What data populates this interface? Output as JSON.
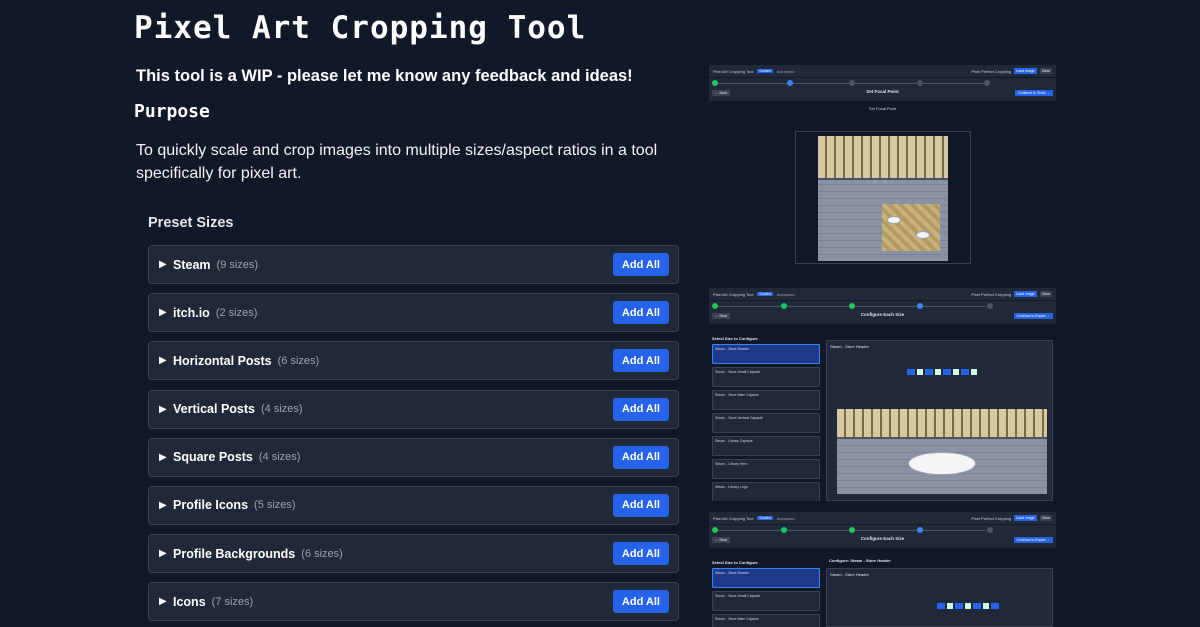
{
  "title": "Pixel Art Cropping Tool",
  "wip_notice": "This tool is a WIP - please let me know any feedback and ideas!",
  "purpose": {
    "heading": "Purpose",
    "text": "To quickly scale and crop images into multiple sizes/aspect ratios in a tool specifically for pixel art."
  },
  "presets": {
    "heading": "Preset Sizes",
    "add_label": "Add All",
    "items": [
      {
        "name": "Steam",
        "count": "(9 sizes)"
      },
      {
        "name": "itch.io",
        "count": "(2 sizes)"
      },
      {
        "name": "Horizontal Posts",
        "count": "(6 sizes)"
      },
      {
        "name": "Vertical Posts",
        "count": "(4 sizes)"
      },
      {
        "name": "Square Posts",
        "count": "(4 sizes)"
      },
      {
        "name": "Profile Icons",
        "count": "(5 sizes)"
      },
      {
        "name": "Profile Backgrounds",
        "count": "(6 sizes)"
      },
      {
        "name": "Icons",
        "count": "(7 sizes)"
      }
    ]
  },
  "screenshots": {
    "app_title": "Pixel Art Cropping Tool",
    "badge": "Guided",
    "advanced": "Advanced",
    "pixel_perfect": "Pixel Perfect Cropping",
    "load": "Load Image",
    "clear": "Clear",
    "back": "← Back",
    "shot1": {
      "heading": "Set Focal Point",
      "continue": "Continue to Sizes →"
    },
    "shot2": {
      "heading": "Configure Each Size",
      "continue": "Continue to Export →",
      "sidebar_heading": "Select Size to Configure",
      "sizes": [
        "Steam - Store Header",
        "Steam - Store Small Capsule",
        "Steam - Store Main Capsule",
        "Steam - Store Vertical Capsule",
        "Steam - Library Capsule",
        "Steam - Library Hero",
        "Steam - Library Logo"
      ]
    },
    "shot3": {
      "heading": "Configure Each Size",
      "continue": "Continue to Export →",
      "sidebar_heading": "Select Size to Configure",
      "panel_title": "Configure: Steam - Store Header",
      "sizes": [
        "Steam - Store Header",
        "Steam - Store Small Capsule",
        "Steam - Store Main Capsule"
      ]
    }
  },
  "colors": {
    "accent": "#2563eb",
    "background": "#111827",
    "card": "#1f2937"
  }
}
